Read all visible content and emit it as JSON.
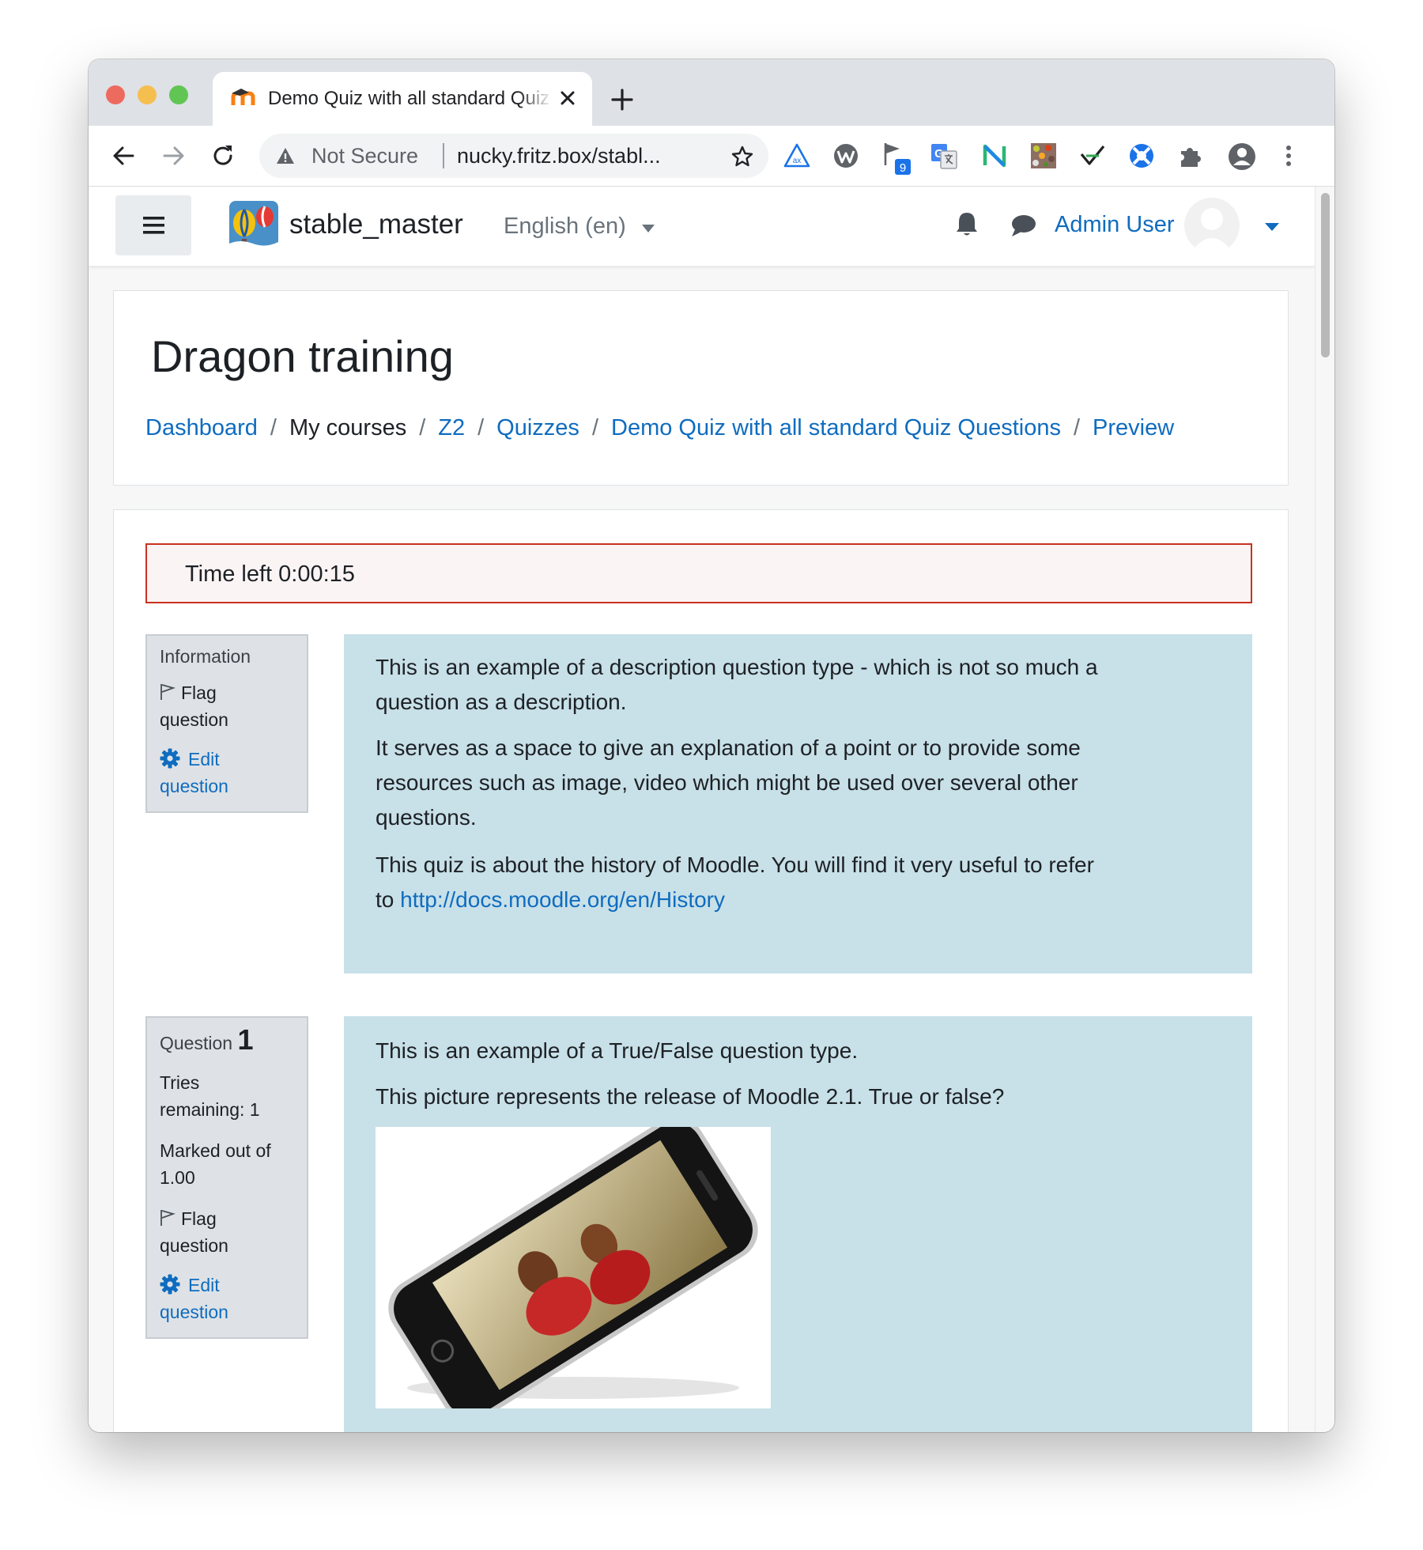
{
  "browser": {
    "tab_title": "Demo Quiz with all standard Quiz Questions",
    "new_tab": "+",
    "omnibox": {
      "security_label": "Not Secure",
      "url": "nucky.fritz.box/stabl..."
    },
    "extension_badge": "9"
  },
  "navbar": {
    "site_name": "stable_master",
    "language": "English (en)",
    "user_name": "Admin User"
  },
  "page": {
    "title": "Dragon training",
    "breadcrumb": [
      {
        "label": "Dashboard"
      },
      {
        "label": "My courses"
      },
      {
        "label": "Z2"
      },
      {
        "label": "Quizzes"
      },
      {
        "label": "Demo Quiz with all standard Quiz Questions"
      },
      {
        "label": "Preview"
      }
    ],
    "breadcrumb_separator": "/"
  },
  "quiz": {
    "timer": "Time left 0:00:15",
    "info_block": {
      "heading": "Information",
      "flag_line1": "Flag",
      "flag_line2": "question",
      "edit_line1": "Edit",
      "edit_line2": "question",
      "lines": [
        "This is an example of a description question type - which is not so much a",
        "question as a description.",
        "It serves as a space to give an explanation of a point or to provide some",
        "resources such as image, video which might be used over several other",
        "questions.",
        "This quiz is about the history of Moodle. You will find it very useful to refer"
      ],
      "last_line_prefix": "to ",
      "link": "http://docs.moodle.org/en/History"
    },
    "question1": {
      "label": "Question",
      "number": "1",
      "tries_line1": "Tries",
      "tries_line2": "remaining: 1",
      "marked_line1": "Marked out of",
      "marked_line2": "1.00",
      "flag_line1": "Flag",
      "flag_line2": "question",
      "edit_line1": "Edit",
      "edit_line2": "question",
      "text1": "This is an example of a True/False question type.",
      "text2": "This picture represents the release of  Moodle 2.1. True or false?"
    }
  },
  "colors": {
    "link": "#0f6cbf",
    "question_bg": "#c8e0e8",
    "info_bg": "#dee2e6",
    "timer_border": "#ca3120",
    "tabstrip": "#dee1e6"
  }
}
